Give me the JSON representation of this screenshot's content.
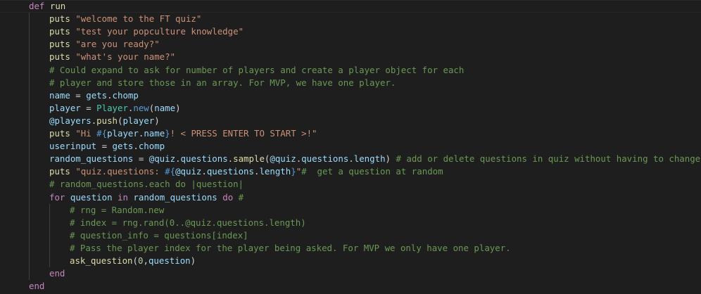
{
  "editor": {
    "language": "ruby",
    "theme": "dark",
    "colors": {
      "background": "#1e1e1e",
      "keyword": "#c586c0",
      "string": "#ce9178",
      "comment": "#6a9955",
      "variable": "#9cdcfe",
      "function": "#dcdcaa",
      "class": "#4ec9b0",
      "number": "#b5cea8",
      "interpolation": "#569cd6"
    },
    "lines": [
      {
        "indent": 1,
        "tokens": [
          {
            "t": "def",
            "c": "kw"
          },
          {
            "t": " "
          },
          {
            "t": "run",
            "c": "fn"
          }
        ]
      },
      {
        "indent": 2,
        "tokens": [
          {
            "t": "puts",
            "c": "fn"
          },
          {
            "t": " "
          },
          {
            "t": "\"welcome to the FT quiz\"",
            "c": "str"
          }
        ]
      },
      {
        "indent": 2,
        "tokens": [
          {
            "t": "puts",
            "c": "fn"
          },
          {
            "t": " "
          },
          {
            "t": "\"test your popculture knowledge\"",
            "c": "str"
          }
        ]
      },
      {
        "indent": 2,
        "tokens": [
          {
            "t": "puts",
            "c": "fn"
          },
          {
            "t": " "
          },
          {
            "t": "\"are you ready?\"",
            "c": "str"
          }
        ]
      },
      {
        "indent": 2,
        "tokens": [
          {
            "t": "puts",
            "c": "fn"
          },
          {
            "t": " "
          },
          {
            "t": "\"what's your name?\"",
            "c": "str"
          }
        ]
      },
      {
        "indent": 2,
        "tokens": [
          {
            "t": "# Could expand to ask for number of players and create a player object for each",
            "c": "cm"
          }
        ]
      },
      {
        "indent": 2,
        "tokens": [
          {
            "t": "# player and store those in an array. For MVP, we have one player.",
            "c": "cm"
          }
        ]
      },
      {
        "indent": 2,
        "tokens": [
          {
            "t": "name",
            "c": "var"
          },
          {
            "t": " = "
          },
          {
            "t": "gets",
            "c": "var"
          },
          {
            "t": "."
          },
          {
            "t": "chomp",
            "c": "var"
          }
        ]
      },
      {
        "indent": 2,
        "tokens": [
          {
            "t": "player",
            "c": "var"
          },
          {
            "t": " = "
          },
          {
            "t": "Player",
            "c": "cls"
          },
          {
            "t": "."
          },
          {
            "t": "new",
            "c": "interp"
          },
          {
            "t": "("
          },
          {
            "t": "name",
            "c": "var"
          },
          {
            "t": ")"
          }
        ]
      },
      {
        "indent": 2,
        "tokens": [
          {
            "t": "@players",
            "c": "var"
          },
          {
            "t": "."
          },
          {
            "t": "push",
            "c": "fn"
          },
          {
            "t": "("
          },
          {
            "t": "player",
            "c": "var"
          },
          {
            "t": ")"
          }
        ]
      },
      {
        "indent": 2,
        "tokens": [
          {
            "t": "puts",
            "c": "fn"
          },
          {
            "t": " "
          },
          {
            "t": "\"Hi ",
            "c": "str"
          },
          {
            "t": "#{",
            "c": "interp"
          },
          {
            "t": "player",
            "c": "var"
          },
          {
            "t": "."
          },
          {
            "t": "name",
            "c": "var"
          },
          {
            "t": "}",
            "c": "interp"
          },
          {
            "t": "! < PRESS ENTER TO START >!\"",
            "c": "str"
          }
        ]
      },
      {
        "indent": 2,
        "tokens": [
          {
            "t": "userinput",
            "c": "var"
          },
          {
            "t": " = "
          },
          {
            "t": "gets",
            "c": "var"
          },
          {
            "t": "."
          },
          {
            "t": "chomp",
            "c": "var"
          }
        ]
      },
      {
        "indent": 2,
        "tokens": [
          {
            "t": "random_questions",
            "c": "var"
          },
          {
            "t": " = "
          },
          {
            "t": "@quiz",
            "c": "var"
          },
          {
            "t": "."
          },
          {
            "t": "questions",
            "c": "var"
          },
          {
            "t": "."
          },
          {
            "t": "sample",
            "c": "fn"
          },
          {
            "t": "("
          },
          {
            "t": "@quiz",
            "c": "var"
          },
          {
            "t": "."
          },
          {
            "t": "questions",
            "c": "var"
          },
          {
            "t": "."
          },
          {
            "t": "length",
            "c": "var"
          },
          {
            "t": ") "
          },
          {
            "t": "# add or delete questions in quiz without having to change anyt",
            "c": "cm"
          }
        ]
      },
      {
        "indent": 2,
        "tokens": [
          {
            "t": "puts",
            "c": "fn"
          },
          {
            "t": " "
          },
          {
            "t": "\"quiz.questions: ",
            "c": "str"
          },
          {
            "t": "#{",
            "c": "interp"
          },
          {
            "t": "@quiz",
            "c": "var"
          },
          {
            "t": "."
          },
          {
            "t": "questions",
            "c": "var"
          },
          {
            "t": "."
          },
          {
            "t": "length",
            "c": "var"
          },
          {
            "t": "}",
            "c": "interp"
          },
          {
            "t": "\"",
            "c": "str"
          },
          {
            "t": "#  get a question at random",
            "c": "cm"
          }
        ]
      },
      {
        "indent": 2,
        "tokens": [
          {
            "t": "# random_questions.each do |question|",
            "c": "cm"
          }
        ]
      },
      {
        "indent": 2,
        "tokens": [
          {
            "t": "for",
            "c": "kw"
          },
          {
            "t": " "
          },
          {
            "t": "question",
            "c": "var"
          },
          {
            "t": " "
          },
          {
            "t": "in",
            "c": "kw"
          },
          {
            "t": " "
          },
          {
            "t": "random_questions",
            "c": "var"
          },
          {
            "t": " "
          },
          {
            "t": "do",
            "c": "kw"
          },
          {
            "t": " "
          },
          {
            "t": "#",
            "c": "cm"
          }
        ]
      },
      {
        "indent": 3,
        "tokens": [
          {
            "t": "# rng = Random.new",
            "c": "cm"
          }
        ]
      },
      {
        "indent": 3,
        "tokens": [
          {
            "t": "# index = rng.rand(0..@quiz.questions.length)",
            "c": "cm"
          }
        ]
      },
      {
        "indent": 3,
        "tokens": [
          {
            "t": "# question_info = questions[index]",
            "c": "cm"
          }
        ]
      },
      {
        "indent": 3,
        "tokens": [
          {
            "t": "# Pass the player index for the player being asked. For MVP we only have one player.",
            "c": "cm"
          }
        ]
      },
      {
        "indent": 3,
        "tokens": [
          {
            "t": "ask_question",
            "c": "fn"
          },
          {
            "t": "("
          },
          {
            "t": "0",
            "c": "num"
          },
          {
            "t": ","
          },
          {
            "t": "question",
            "c": "var"
          },
          {
            "t": ")"
          }
        ]
      },
      {
        "indent": 2,
        "tokens": [
          {
            "t": "end",
            "c": "kw"
          }
        ]
      },
      {
        "indent": 1,
        "tokens": [
          {
            "t": "end",
            "c": "kw"
          }
        ]
      }
    ]
  }
}
